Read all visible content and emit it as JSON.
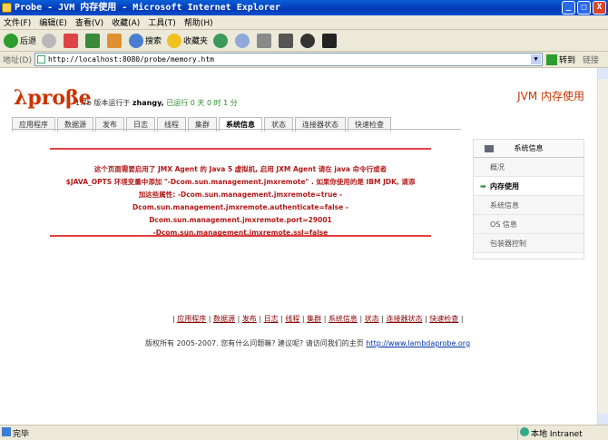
{
  "window": {
    "title": "Probe - JVM 内存使用 - Microsoft Internet Explorer",
    "min": "_",
    "max": "□",
    "close": "X"
  },
  "menu": [
    "文件(F)",
    "编辑(E)",
    "查看(V)",
    "收藏(A)",
    "工具(T)",
    "帮助(H)"
  ],
  "toolbar": {
    "back": "后退",
    "search": "搜索",
    "favorites": "收藏夹"
  },
  "address": {
    "label": "地址(D)",
    "url": "http://localhost:8080/probe/memory.htm",
    "go": "转到",
    "links": "链接"
  },
  "header": {
    "logo": "λproβe",
    "version_prefix": "1.7b 版本运行于",
    "user": "zhangy,",
    "uptime": "已运行 0 天 0 时 1 分",
    "page_title": "JVM 内存使用"
  },
  "tabs": [
    "应用程序",
    "数据源",
    "发布",
    "日志",
    "线程",
    "集群",
    "系统信息",
    "状态",
    "连接器状态",
    "快速检查"
  ],
  "alert": {
    "line1": "这个页面需要启用了 JMX Agent 的 Java 5 虚拟机, 启用 JXM Agent 请在 java 命令行或者",
    "line2": "$JAVA_OPTS 环境变量中添加 \"-Dcom.sun.management.jmxremote\" . 如果你使用的是 IBM JDK, 请添",
    "line3": "加这些属性: -Dcom.sun.management.jmxremote=true -",
    "line4": "Dcom.sun.management.jmxremote.authenticate=false -Dcom.sun.management.jmxremote.port=29001",
    "line5": "-Dcom.sun.management.jmxremote.ssl=false"
  },
  "sidebar": {
    "title": "系统信息",
    "items": [
      "概况",
      "内存使用",
      "系统信息",
      "OS 信息",
      "包装器控制"
    ]
  },
  "footer": {
    "links": [
      "应用程序",
      "数据源",
      "发布",
      "日志",
      "线程",
      "集群",
      "系统信息",
      "状态",
      "连接器状态",
      "快速检查"
    ],
    "copyright": "版权所有 2005-2007. 您有什么问题嘛? 建议呢? 请访问我们的主页",
    "homepage": "http://www.lambdaprobe.org"
  },
  "status": {
    "left": "完毕",
    "zone": "本地 Intranet"
  }
}
